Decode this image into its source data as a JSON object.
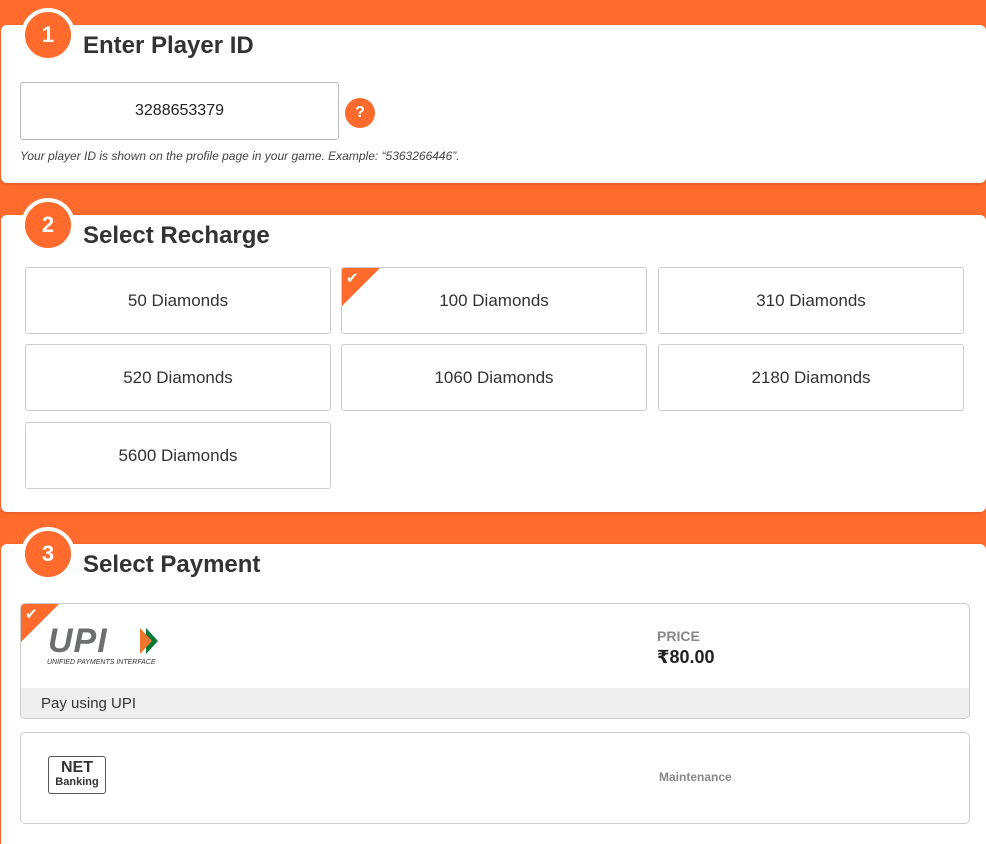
{
  "step1": {
    "number": "1",
    "title": "Enter Player ID",
    "player_id_value": "3288653379",
    "help_icon": "?",
    "hint": "Your player ID is shown on the profile page in your game. Example: “5363266446”."
  },
  "step2": {
    "number": "2",
    "title": "Select Recharge",
    "selected_index": 1,
    "items": [
      {
        "label": "50 Diamonds"
      },
      {
        "label": "100 Diamonds"
      },
      {
        "label": "310 Diamonds"
      },
      {
        "label": "520 Diamonds"
      },
      {
        "label": "1060 Diamonds"
      },
      {
        "label": "2180 Diamonds"
      },
      {
        "label": "5600 Diamonds"
      }
    ]
  },
  "step3": {
    "number": "3",
    "title": "Select Payment",
    "upi": {
      "logo_text": "UPI",
      "logo_subtext": "UNIFIED PAYMENTS INTERFACE",
      "price_label": "PRICE",
      "price_value": "₹80.00",
      "footer": "Pay using UPI"
    },
    "netbanking": {
      "logo_top": "NET",
      "logo_bottom": "Banking",
      "status": "Maintenance"
    }
  },
  "icons": {
    "check": "✔"
  },
  "colors": {
    "accent": "#ff6b2c",
    "card_bg": "#ffffff",
    "footer_bg": "#eeeeee"
  }
}
